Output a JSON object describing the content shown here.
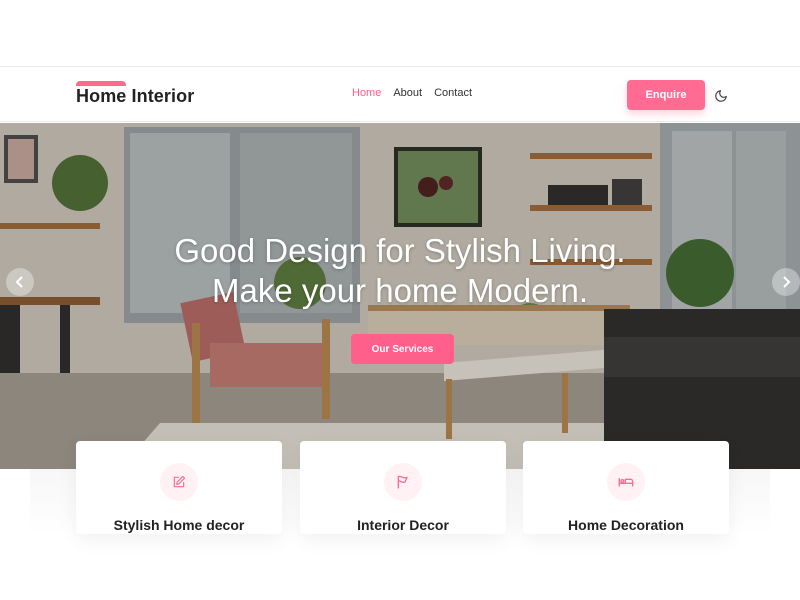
{
  "brand": {
    "name": "Home Interior"
  },
  "nav": {
    "links": [
      {
        "label": "Home",
        "active": true
      },
      {
        "label": "About",
        "active": false
      },
      {
        "label": "Contact",
        "active": false
      }
    ],
    "enquire_label": "Enquire"
  },
  "hero": {
    "title_line1": "Good Design for Stylish Living.",
    "title_line2": "Make your home Modern.",
    "cta_label": "Our Services"
  },
  "features": [
    {
      "title": "Stylish Home decor",
      "icon": "edit-icon"
    },
    {
      "title": "Interior Decor",
      "icon": "flag-icon"
    },
    {
      "title": "Home Decoration",
      "icon": "bed-icon"
    }
  ],
  "colors": {
    "accent": "#ff6b93",
    "accent_light": "#fff1f4",
    "text": "#222222"
  }
}
